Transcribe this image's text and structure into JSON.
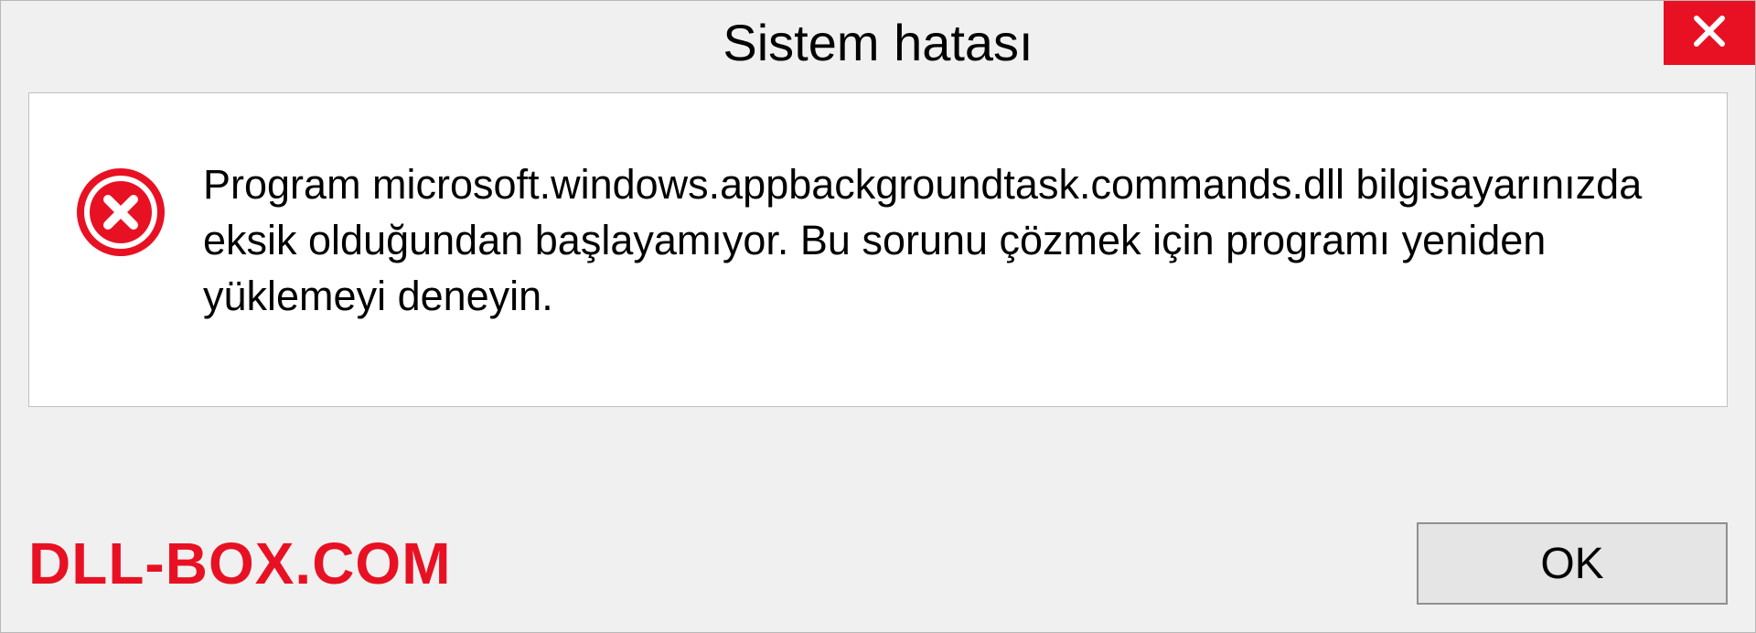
{
  "dialog": {
    "title": "Sistem hatası",
    "message": "Program microsoft.windows.appbackgroundtask.commands.dll bilgisayarınızda eksik olduğundan başlayamıyor. Bu sorunu çözmek için programı yeniden yüklemeyi deneyin.",
    "ok_label": "OK"
  },
  "watermark": "DLL-BOX.COM",
  "colors": {
    "error_red": "#e81123",
    "dialog_bg": "#f0f0f0",
    "content_bg": "#ffffff"
  }
}
